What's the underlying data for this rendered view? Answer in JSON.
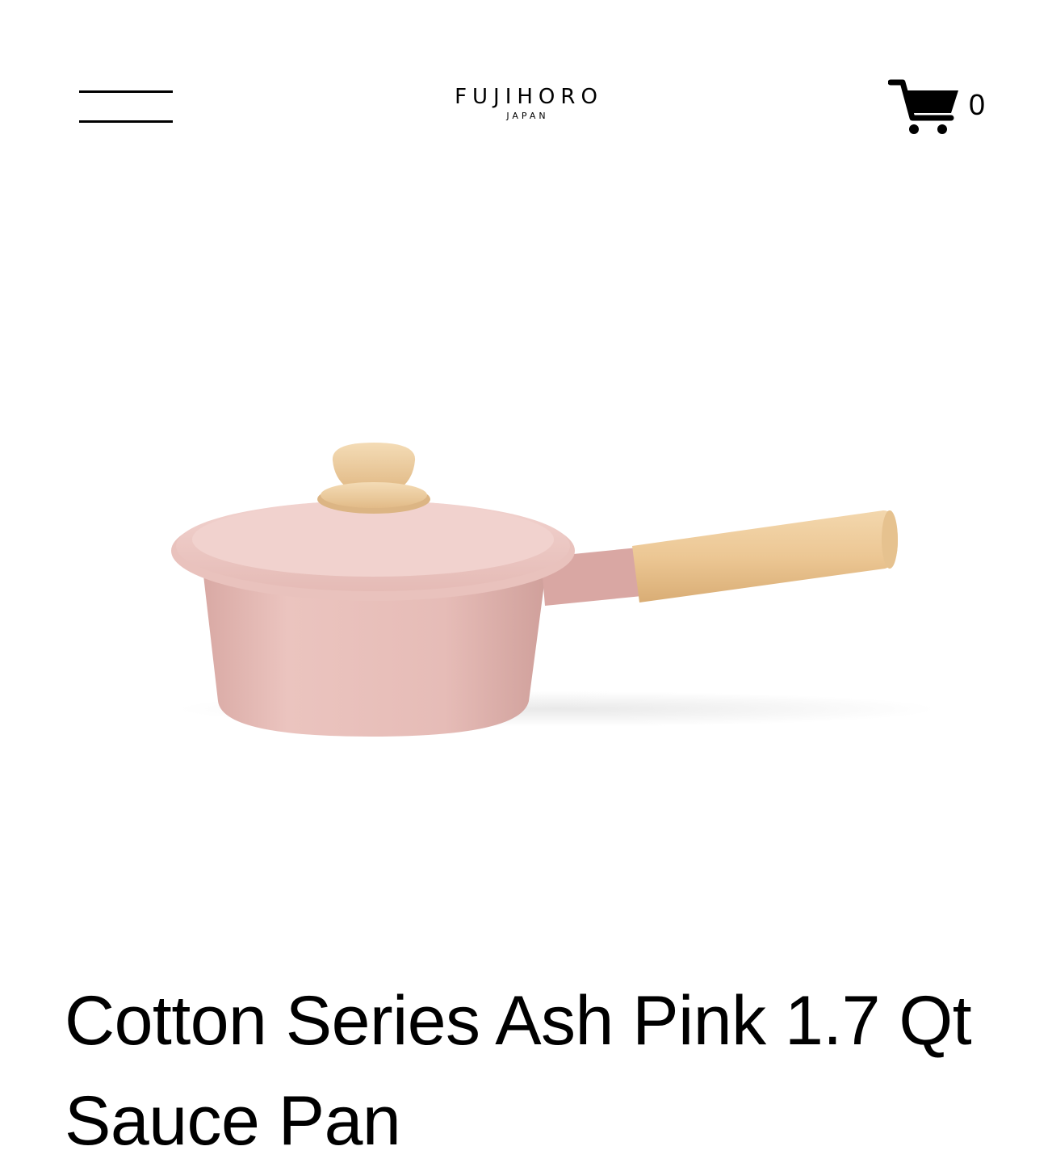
{
  "header": {
    "menu_icon": "hamburger-menu-icon",
    "logo": {
      "name": "FUJIHORO",
      "subtitle": "JAPAN"
    },
    "cart": {
      "icon": "shopping-cart-icon",
      "count": "0"
    }
  },
  "product": {
    "title": "Cotton Series Ash Pink 1.7 Qt Sauce Pan",
    "colors": {
      "enamel": "#e7bfba",
      "wood": "#ecc99a"
    }
  }
}
